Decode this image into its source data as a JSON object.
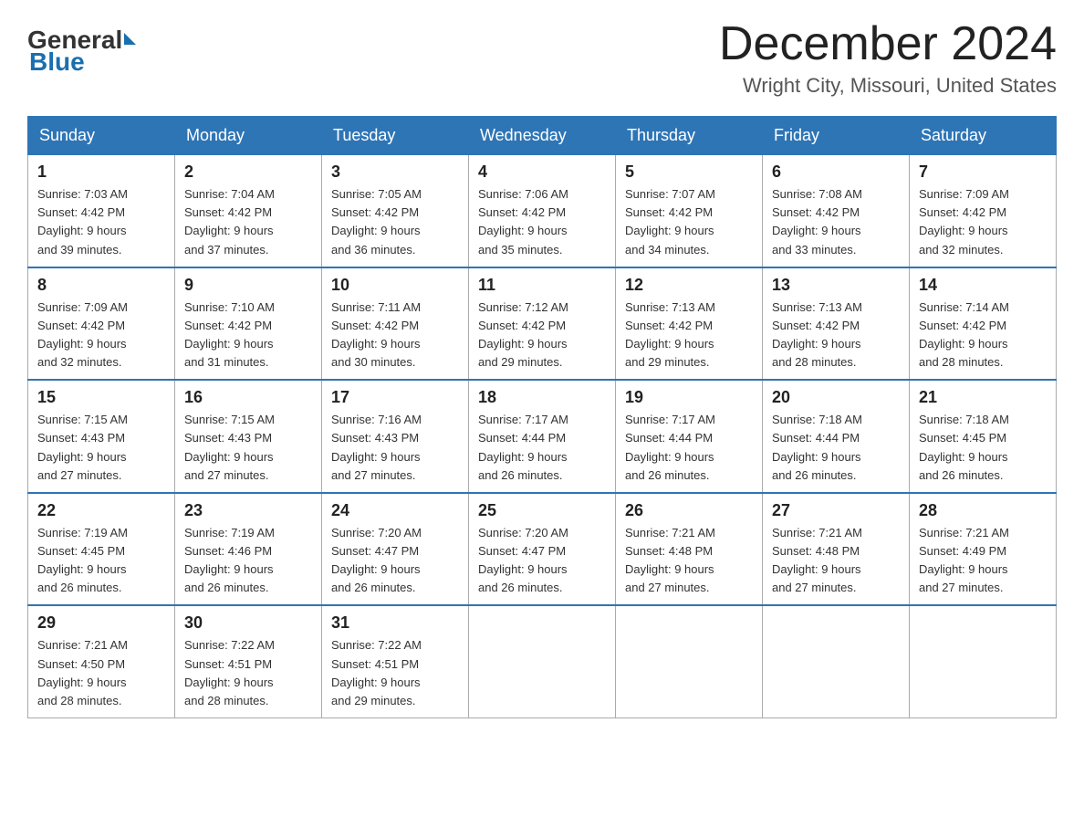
{
  "header": {
    "logo_general": "General",
    "logo_blue": "Blue",
    "title": "December 2024",
    "subtitle": "Wright City, Missouri, United States"
  },
  "days_of_week": [
    "Sunday",
    "Monday",
    "Tuesday",
    "Wednesday",
    "Thursday",
    "Friday",
    "Saturday"
  ],
  "weeks": [
    [
      {
        "day": "1",
        "sunrise": "7:03 AM",
        "sunset": "4:42 PM",
        "daylight": "9 hours and 39 minutes."
      },
      {
        "day": "2",
        "sunrise": "7:04 AM",
        "sunset": "4:42 PM",
        "daylight": "9 hours and 37 minutes."
      },
      {
        "day": "3",
        "sunrise": "7:05 AM",
        "sunset": "4:42 PM",
        "daylight": "9 hours and 36 minutes."
      },
      {
        "day": "4",
        "sunrise": "7:06 AM",
        "sunset": "4:42 PM",
        "daylight": "9 hours and 35 minutes."
      },
      {
        "day": "5",
        "sunrise": "7:07 AM",
        "sunset": "4:42 PM",
        "daylight": "9 hours and 34 minutes."
      },
      {
        "day": "6",
        "sunrise": "7:08 AM",
        "sunset": "4:42 PM",
        "daylight": "9 hours and 33 minutes."
      },
      {
        "day": "7",
        "sunrise": "7:09 AM",
        "sunset": "4:42 PM",
        "daylight": "9 hours and 32 minutes."
      }
    ],
    [
      {
        "day": "8",
        "sunrise": "7:09 AM",
        "sunset": "4:42 PM",
        "daylight": "9 hours and 32 minutes."
      },
      {
        "day": "9",
        "sunrise": "7:10 AM",
        "sunset": "4:42 PM",
        "daylight": "9 hours and 31 minutes."
      },
      {
        "day": "10",
        "sunrise": "7:11 AM",
        "sunset": "4:42 PM",
        "daylight": "9 hours and 30 minutes."
      },
      {
        "day": "11",
        "sunrise": "7:12 AM",
        "sunset": "4:42 PM",
        "daylight": "9 hours and 29 minutes."
      },
      {
        "day": "12",
        "sunrise": "7:13 AM",
        "sunset": "4:42 PM",
        "daylight": "9 hours and 29 minutes."
      },
      {
        "day": "13",
        "sunrise": "7:13 AM",
        "sunset": "4:42 PM",
        "daylight": "9 hours and 28 minutes."
      },
      {
        "day": "14",
        "sunrise": "7:14 AM",
        "sunset": "4:42 PM",
        "daylight": "9 hours and 28 minutes."
      }
    ],
    [
      {
        "day": "15",
        "sunrise": "7:15 AM",
        "sunset": "4:43 PM",
        "daylight": "9 hours and 27 minutes."
      },
      {
        "day": "16",
        "sunrise": "7:15 AM",
        "sunset": "4:43 PM",
        "daylight": "9 hours and 27 minutes."
      },
      {
        "day": "17",
        "sunrise": "7:16 AM",
        "sunset": "4:43 PM",
        "daylight": "9 hours and 27 minutes."
      },
      {
        "day": "18",
        "sunrise": "7:17 AM",
        "sunset": "4:44 PM",
        "daylight": "9 hours and 26 minutes."
      },
      {
        "day": "19",
        "sunrise": "7:17 AM",
        "sunset": "4:44 PM",
        "daylight": "9 hours and 26 minutes."
      },
      {
        "day": "20",
        "sunrise": "7:18 AM",
        "sunset": "4:44 PM",
        "daylight": "9 hours and 26 minutes."
      },
      {
        "day": "21",
        "sunrise": "7:18 AM",
        "sunset": "4:45 PM",
        "daylight": "9 hours and 26 minutes."
      }
    ],
    [
      {
        "day": "22",
        "sunrise": "7:19 AM",
        "sunset": "4:45 PM",
        "daylight": "9 hours and 26 minutes."
      },
      {
        "day": "23",
        "sunrise": "7:19 AM",
        "sunset": "4:46 PM",
        "daylight": "9 hours and 26 minutes."
      },
      {
        "day": "24",
        "sunrise": "7:20 AM",
        "sunset": "4:47 PM",
        "daylight": "9 hours and 26 minutes."
      },
      {
        "day": "25",
        "sunrise": "7:20 AM",
        "sunset": "4:47 PM",
        "daylight": "9 hours and 26 minutes."
      },
      {
        "day": "26",
        "sunrise": "7:21 AM",
        "sunset": "4:48 PM",
        "daylight": "9 hours and 27 minutes."
      },
      {
        "day": "27",
        "sunrise": "7:21 AM",
        "sunset": "4:48 PM",
        "daylight": "9 hours and 27 minutes."
      },
      {
        "day": "28",
        "sunrise": "7:21 AM",
        "sunset": "4:49 PM",
        "daylight": "9 hours and 27 minutes."
      }
    ],
    [
      {
        "day": "29",
        "sunrise": "7:21 AM",
        "sunset": "4:50 PM",
        "daylight": "9 hours and 28 minutes."
      },
      {
        "day": "30",
        "sunrise": "7:22 AM",
        "sunset": "4:51 PM",
        "daylight": "9 hours and 28 minutes."
      },
      {
        "day": "31",
        "sunrise": "7:22 AM",
        "sunset": "4:51 PM",
        "daylight": "9 hours and 29 minutes."
      },
      null,
      null,
      null,
      null
    ]
  ],
  "labels": {
    "sunrise": "Sunrise:",
    "sunset": "Sunset:",
    "daylight": "Daylight:"
  }
}
